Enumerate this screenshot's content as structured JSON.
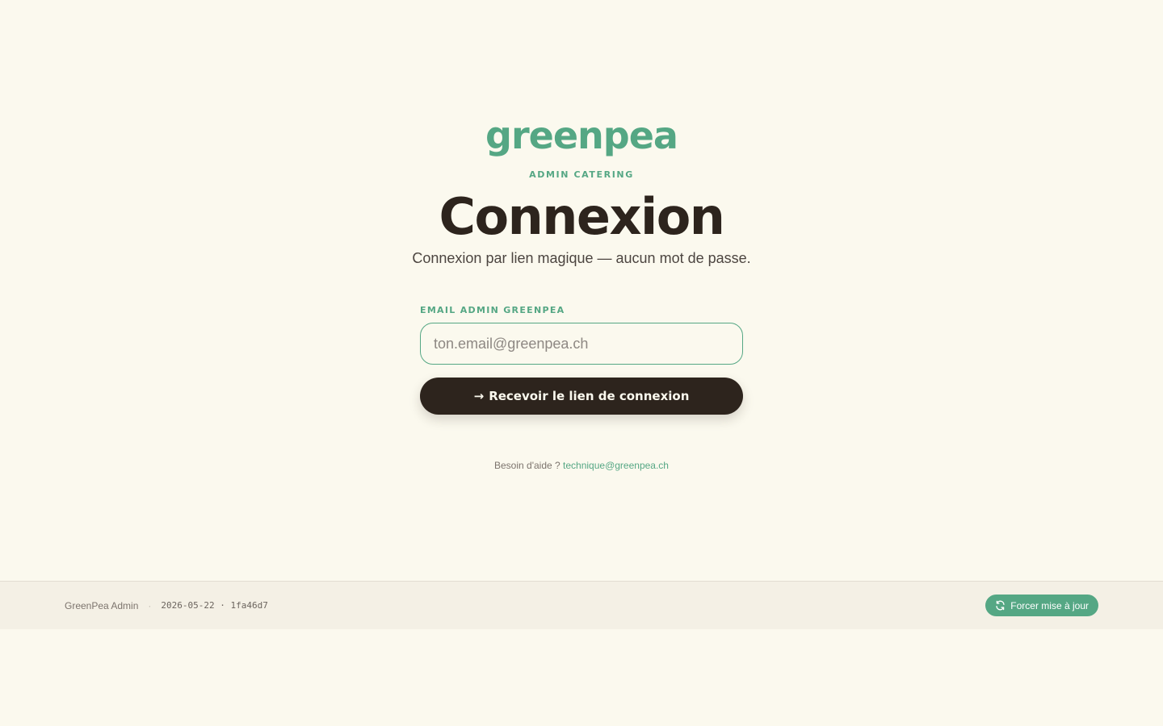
{
  "brand": {
    "logo": "greenpea",
    "eyebrow": "ADMIN CATERING",
    "accent_color": "#55a784",
    "dark_color": "#2d241d"
  },
  "login": {
    "title": "Connexion",
    "subtitle": "Connexion par lien magique — aucun mot de passe.",
    "email_label": "EMAIL ADMIN GREENPEA",
    "email_placeholder": "ton.email@greenpea.ch",
    "email_value": "",
    "submit_arrow": "→",
    "submit_label": "Recevoir le lien de connexion",
    "help_text": "Besoin d'aide ?",
    "help_email": "technique@greenpea.ch"
  },
  "footer": {
    "app_name": "GreenPea Admin",
    "separator": "·",
    "version": "2026-05-22 · 1fa46d7",
    "update_icon": "refresh-icon",
    "update_label": "Forcer mise à jour"
  }
}
